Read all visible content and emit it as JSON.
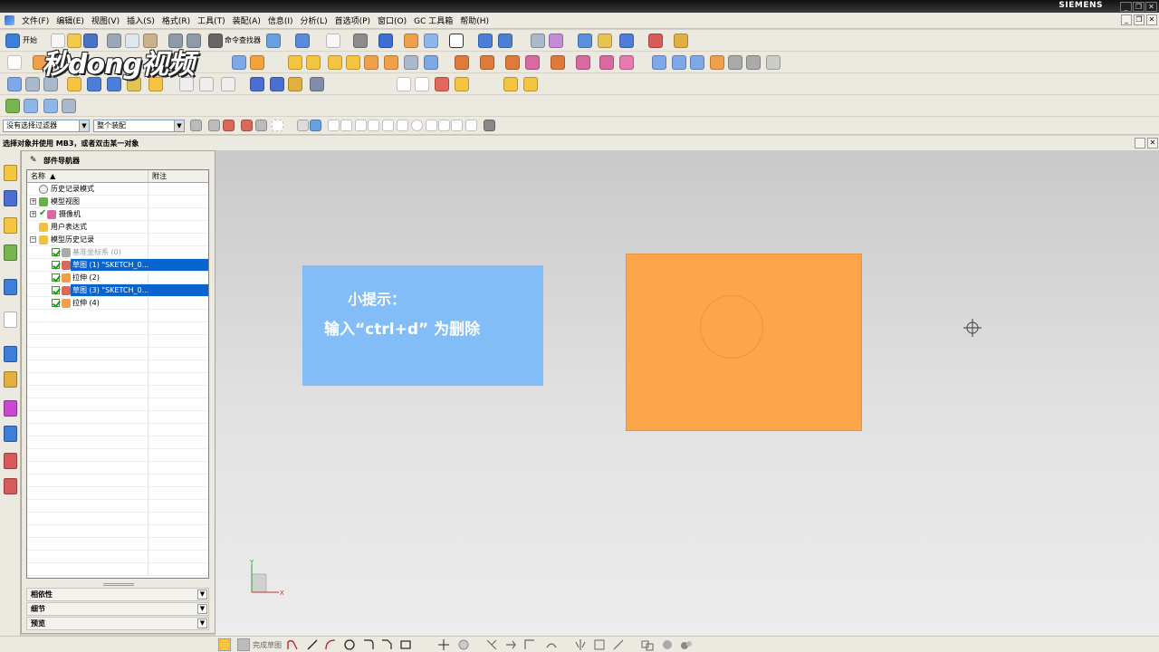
{
  "window": {
    "brand": "SIEMENS",
    "controls": [
      "_",
      "❐",
      "✕"
    ],
    "mdi_controls": [
      "_",
      "❐",
      "✕"
    ]
  },
  "menu": [
    "文件(F)",
    "编辑(E)",
    "视图(V)",
    "插入(S)",
    "格式(R)",
    "工具(T)",
    "装配(A)",
    "信息(I)",
    "分析(L)",
    "首选项(P)",
    "窗口(O)",
    "GC 工具箱",
    "帮助(H)"
  ],
  "toolbar": {
    "start_label": "开始",
    "command_finder_label": "命令查找器"
  },
  "logo_text": "秒dong视频",
  "filter": {
    "selection_filter": "没有选择过滤器",
    "assembly_scope": "整个装配"
  },
  "status_text": "选择对象并使用 MB3，或者双击某一对象",
  "navigator": {
    "title": "部件导航器",
    "columns": [
      "名称",
      "附注"
    ],
    "rows": [
      {
        "label": "历史记录模式"
      },
      {
        "label": "模型视图"
      },
      {
        "label": "摄像机"
      },
      {
        "label": "用户表达式"
      },
      {
        "label": "模型历史记录"
      },
      {
        "label": "基准坐标系 (0)"
      },
      {
        "label": "草图 (1) \"SKETCH_0..."
      },
      {
        "label": "拉伸 (2)"
      },
      {
        "label": "草图 (3) \"SKETCH_0..."
      },
      {
        "label": "拉伸 (4)"
      }
    ],
    "sections": [
      "相依性",
      "细节",
      "预览"
    ]
  },
  "hint": {
    "title": "小提示：",
    "body": "输入“ctrl+d” 为删除"
  },
  "axis": {
    "x": "X",
    "y": "Y"
  },
  "sketch_bar": {
    "finish_label": "完成草图"
  },
  "colors": {
    "hint_bg": "#82bdf8",
    "part_fill": "#fca54a",
    "selection": "#0a64d0",
    "title_bar": "#1a1a1a"
  }
}
